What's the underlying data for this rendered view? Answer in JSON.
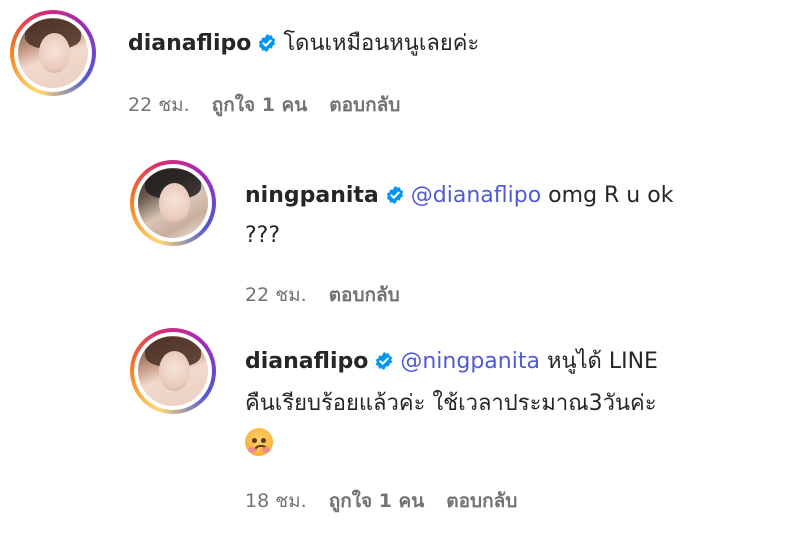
{
  "comments": [
    {
      "username": "dianaflipo",
      "text": "โดนเหมือนหนูเลยค่ะ",
      "time": "22 ชม.",
      "likes": "ถูกใจ 1 คน",
      "reply_label": "ตอบกลับ"
    },
    {
      "username": "ningpanita",
      "mention": "@dianaflipo",
      "text_line1": "omg R u ok",
      "text_line2": "???",
      "time": "22 ชม.",
      "reply_label": "ตอบกลับ"
    },
    {
      "username": "dianaflipo",
      "mention": "@ningpanita",
      "text_line1": "หนูได้ LINE",
      "text_line2": "คืนเรียบร้อยแล้วค่ะ ใช้เวลาประมาณ3วันค่ะ",
      "emoji": "hot-face-emoji",
      "time": "18 ชม.",
      "likes": "ถูกใจ 1 คน",
      "reply_label": "ตอบกลับ"
    }
  ],
  "colors": {
    "mention": "#4f5bd5",
    "verified": "#0095f6",
    "meta": "#737373"
  }
}
